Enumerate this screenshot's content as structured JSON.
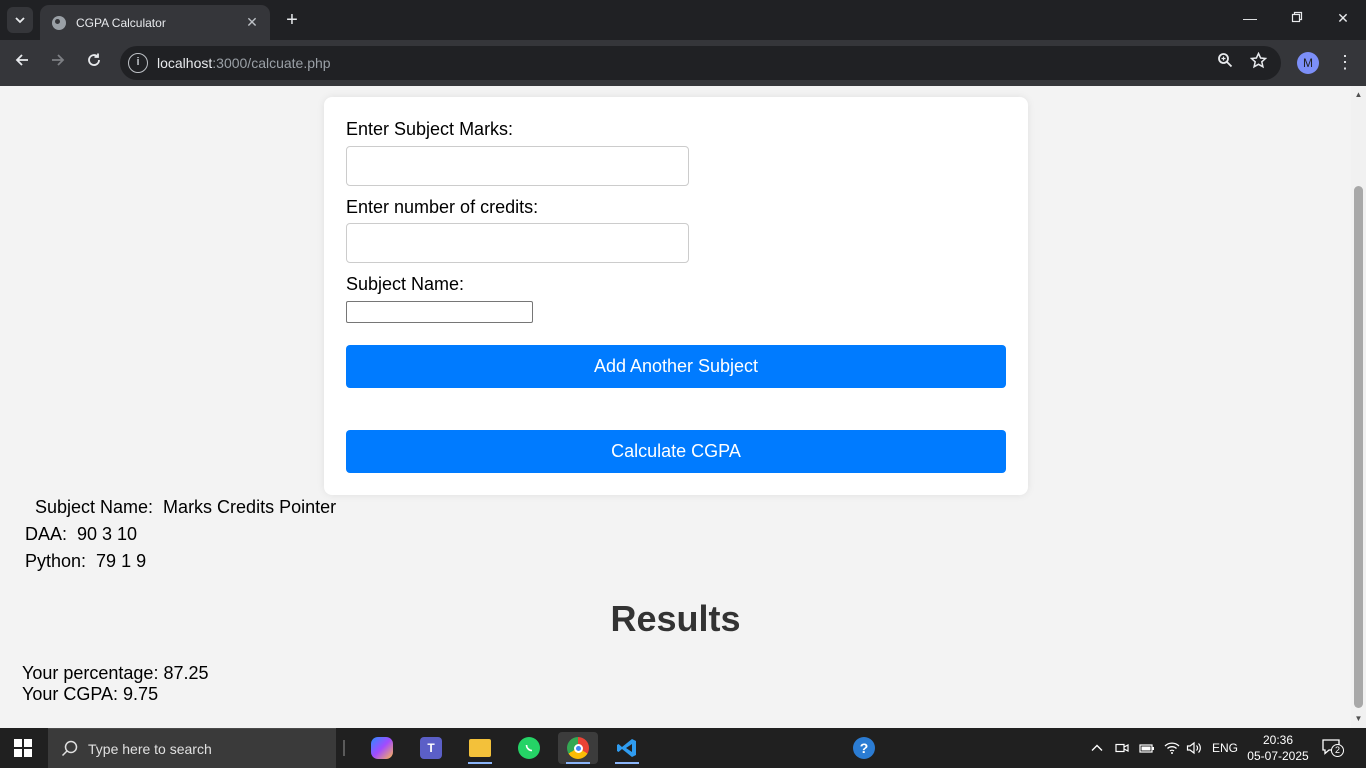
{
  "browser": {
    "tab_title": "CGPA Calculator",
    "url_host": "localhost",
    "url_rest": ":3000/calcuate.php",
    "avatar_initial": "M"
  },
  "form": {
    "marks_label": "Enter Subject Marks:",
    "marks_value": "",
    "credits_label": "Enter number of credits:",
    "credits_value": "",
    "subject_name_label": "Subject Name:",
    "subject_name_value": "",
    "add_subject_button": "Add Another Subject",
    "calculate_button": "Calculate CGPA"
  },
  "subjects": {
    "header": " Subject Name:  Marks Credits Pointer",
    "rows": [
      "DAA:  90 3 10",
      "Python:  79 1 9"
    ]
  },
  "results": {
    "heading": "Results",
    "percentage_line": "Your percentage: 87.25",
    "cgpa_line": "Your CGPA: 9.75"
  },
  "taskbar": {
    "search_placeholder": "Type here to search",
    "language": "ENG",
    "time": "20:36",
    "date": "05-07-2025",
    "notification_count": "2"
  },
  "colors": {
    "accent_button": "#007bff",
    "page_background": "#f3f3f3",
    "card_background": "#ffffff"
  }
}
